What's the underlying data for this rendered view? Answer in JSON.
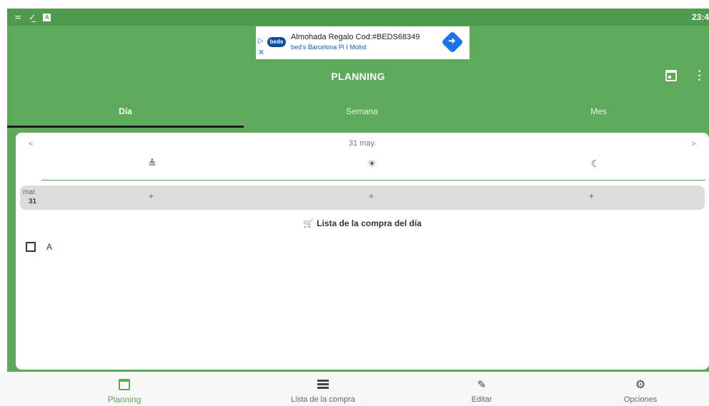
{
  "status_bar": {
    "icons": [
      "≍",
      "✓̲",
      "A"
    ],
    "time": "23:4"
  },
  "ad": {
    "logo": "beds",
    "title": "Almohada Regalo Cod:#BEDS68349",
    "subtitle": "bed's Barcelona Pl I Molist"
  },
  "app_bar": {
    "title": "PLANNING"
  },
  "tabs": [
    {
      "label": "Día",
      "active": true
    },
    {
      "label": "Semana",
      "active": false
    },
    {
      "label": "Mes",
      "active": false
    }
  ],
  "planner": {
    "prev": "<",
    "next": ">",
    "date": "31 may.",
    "meals": [
      "sunrise-icon",
      "sun-icon",
      "moon-icon"
    ],
    "day": {
      "weekday": "mar.",
      "number": "31"
    },
    "add_symbol": "+"
  },
  "shopping": {
    "title": "Lista de la compra del día",
    "items": [
      {
        "text": "A",
        "checked": false
      }
    ]
  },
  "bottom_nav": [
    {
      "label": "Planning",
      "icon": "calendar-icon",
      "active": true
    },
    {
      "label": "Lista de la compra",
      "icon": "list-icon",
      "active": false
    },
    {
      "label": "Editar",
      "icon": "pencil-icon",
      "active": false
    },
    {
      "label": "Opciones",
      "icon": "gear-icon",
      "active": false
    }
  ],
  "colors": {
    "primary": "#5daa5a",
    "status_bar": "#4f9a4d",
    "indicator": "#1b1b1b",
    "day_row": "#dcdcdc",
    "ad_blue": "#1a73e8"
  }
}
